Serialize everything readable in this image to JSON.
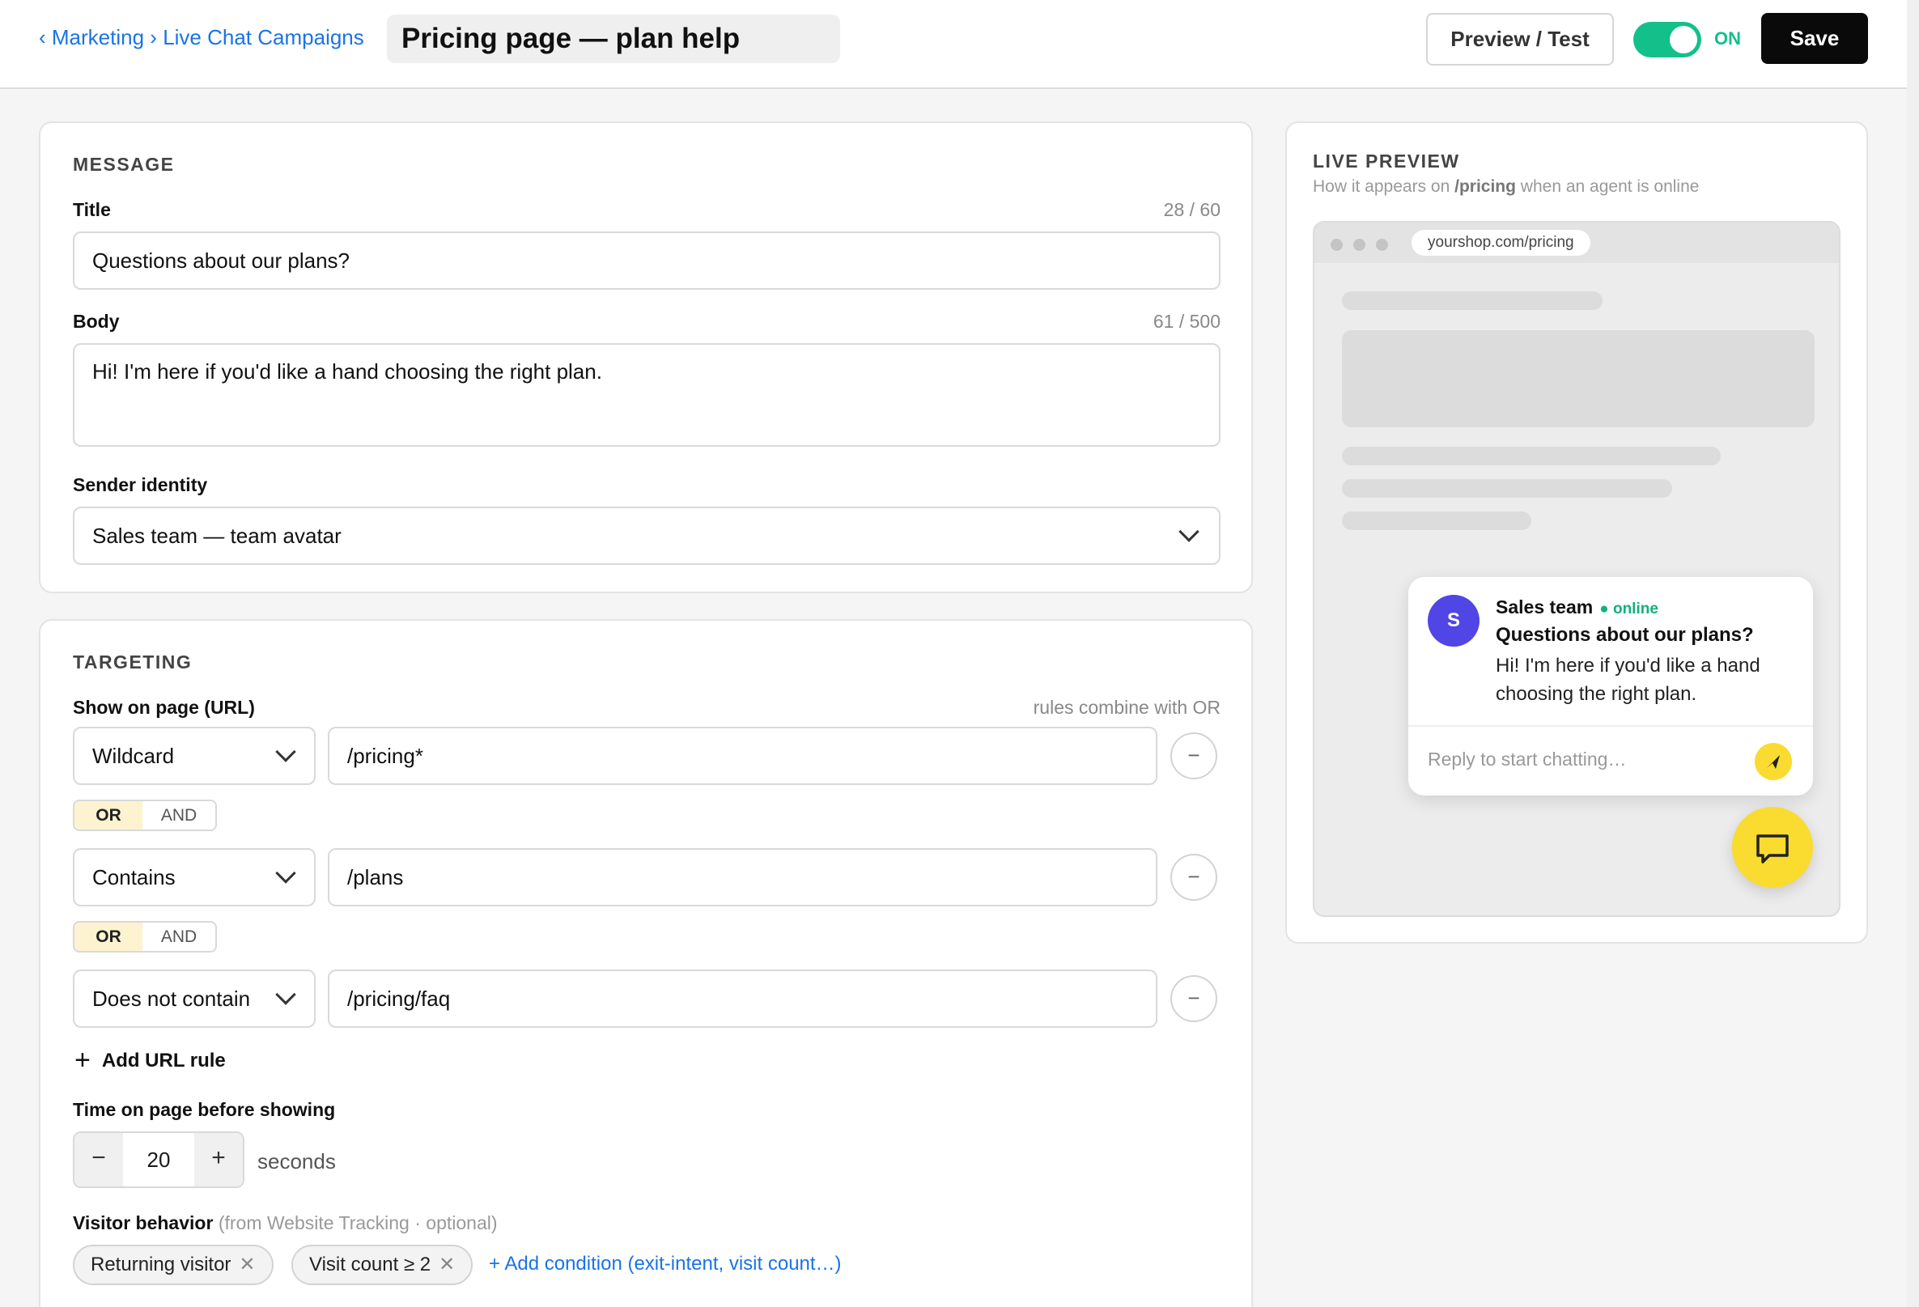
{
  "header": {
    "breadcrumb": [
      "‹ Marketing",
      "›",
      "Live Chat Campaigns"
    ],
    "campaign_title": "Pricing page — plan help",
    "preview_label": "Preview / Test",
    "toggle_state": "ON",
    "save_label": "Save",
    "accent_color": "#14c08a"
  },
  "message": {
    "section_title": "MESSAGE",
    "title_label": "Title",
    "title_counter": "28 / 60",
    "title_value": "Questions about our plans?",
    "body_label": "Body",
    "body_counter": "61 / 500",
    "body_value": "Hi! I'm here if you'd like a hand choosing the right plan.",
    "sender_label": "Sender identity",
    "sender_value": "Sales team — team avatar"
  },
  "targeting": {
    "section_title": "TARGETING",
    "url_label": "Show on page (URL)",
    "url_hint": "rules combine with OR",
    "rules": [
      {
        "match": "Wildcard",
        "value": "/pricing*"
      },
      {
        "match": "Contains",
        "value": "/plans"
      },
      {
        "match": "Does not contain",
        "value": "/pricing/faq"
      }
    ],
    "remove_glyph": "−",
    "connectors": [
      {
        "on": "OR",
        "off": "AND"
      },
      {
        "on": "OR",
        "off": "AND"
      }
    ],
    "add_rule_label": "Add URL rule",
    "time_label": "Time on page before showing",
    "time_value": "20",
    "time_units": "seconds",
    "behavior_label": "Visitor behavior",
    "behavior_hint": "(from Website Tracking · optional)",
    "chips": [
      "Returning visitor",
      "Visit count ≥ 2"
    ],
    "add_condition_label": "+ Add condition (exit-intent, visit count…)"
  },
  "preview": {
    "section_title": "LIVE PREVIEW",
    "subtitle_prefix": "How it appears on",
    "subtitle_path": "/pricing",
    "subtitle_suffix": "when an agent is online",
    "url": "yourshop.com/pricing",
    "avatar_initial": "S",
    "sender": "Sales team",
    "status": "● online",
    "title": "Questions about our plans?",
    "body": "Hi! I'm here if you'd like a hand choosing the right plan.",
    "reply_placeholder": "Reply to start chatting…",
    "launcher_color": "#fadb2f",
    "avatar_color": "#5046e5"
  }
}
